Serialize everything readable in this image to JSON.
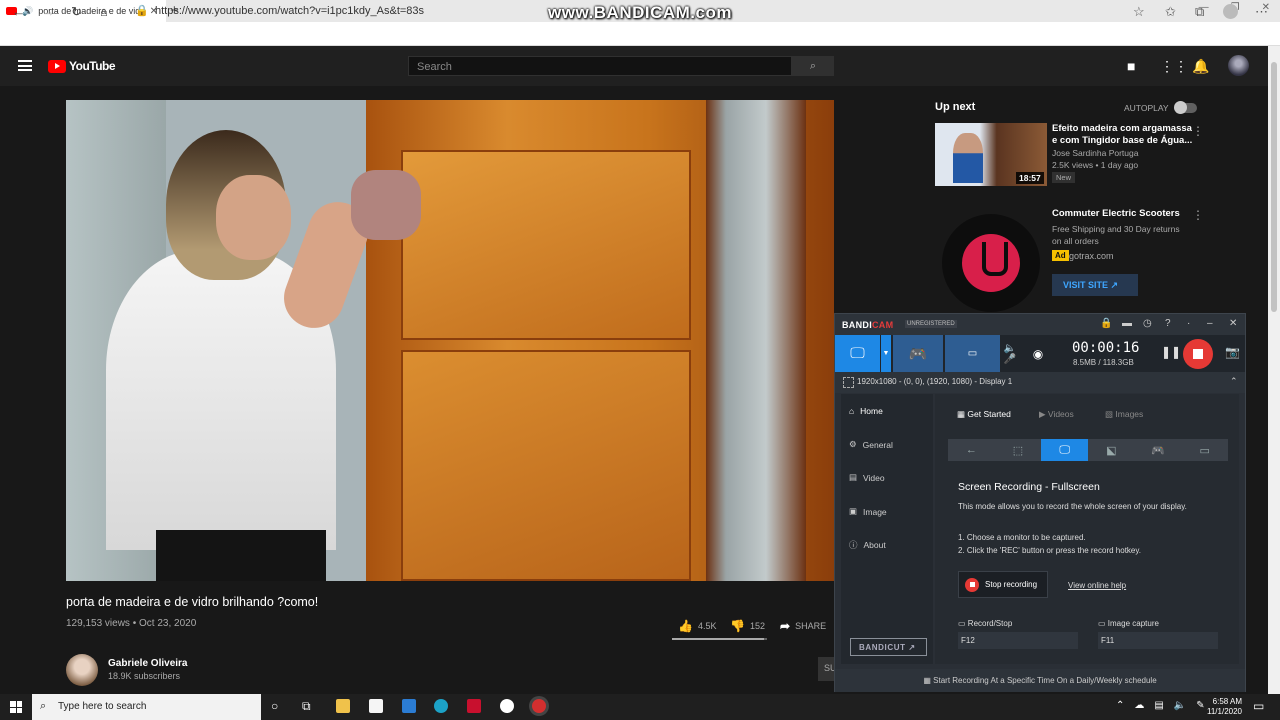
{
  "browser": {
    "tab_title": "porta de madeira e de vidr",
    "url": "https://www.youtube.com/watch?v=i1pc1kdy_As&t=83s",
    "watermark": "www.BANDICAM.com"
  },
  "youtube": {
    "logo_text": "YouTube",
    "search_placeholder": "Search",
    "video": {
      "title": "porta de madeira e de vidro brilhando ?como!",
      "meta": "129,153 views • Oct 23, 2020",
      "likes": "4.5K",
      "dislikes": "152",
      "share_label": "SHARE",
      "like_ratio": 0.97
    },
    "channel": {
      "name": "Gabriele Oliveira",
      "subs": "18.9K subscribers",
      "subscribe_label": "SU"
    },
    "upnext": {
      "heading": "Up next",
      "autoplay_label": "AUTOPLAY",
      "item1": {
        "title_line1": "Efeito madeira com argamassa",
        "title_line2": "e com Tingidor base de Água...",
        "channel": "Jose Sardinha Portuga",
        "meta": "2.5K views • 1 day ago",
        "badge": "New",
        "duration": "18:57"
      },
      "ad": {
        "title": "Commuter Electric Scooters",
        "desc_line1": "Free Shipping and 30 Day returns",
        "desc_line2": "on all orders",
        "ad_tag": "Ad",
        "domain": "gotrax.com",
        "visit_label": "VISIT SITE"
      }
    }
  },
  "bandicam": {
    "logo_prefix": "BANDI",
    "logo_suffix": "CAM",
    "unregistered": "UNREGISTERED",
    "timer": "00:00:16",
    "size": "8.5MB / 118.3GB",
    "display_info": "1920x1080 - (0, 0), (1920, 1080) - Display 1",
    "sidebar": {
      "home": "Home",
      "general": "General",
      "video": "Video",
      "image": "Image",
      "about": "About"
    },
    "bandicut_label": "BANDICUT ↗",
    "tabs": {
      "get_started": "Get Started",
      "videos": "Videos",
      "images": "Images"
    },
    "mode_title": "Screen Recording - Fullscreen",
    "mode_desc": "This mode allows you to record the whole screen of your display.",
    "step1": "1. Choose a monitor to be captured.",
    "step2": "2. Click the 'REC' button or press the record hotkey.",
    "stop_label": "Stop recording",
    "online_help": "View online help",
    "hotkey_record_label": "Record/Stop",
    "hotkey_record_value": "F12",
    "hotkey_image_label": "Image capture",
    "hotkey_image_value": "F11",
    "schedule": "Start Recording At a Specific Time On a Daily/Weekly schedule"
  },
  "taskbar": {
    "search_placeholder": "Type here to search",
    "time": "6:58 AM",
    "date": "11/1/2020"
  }
}
